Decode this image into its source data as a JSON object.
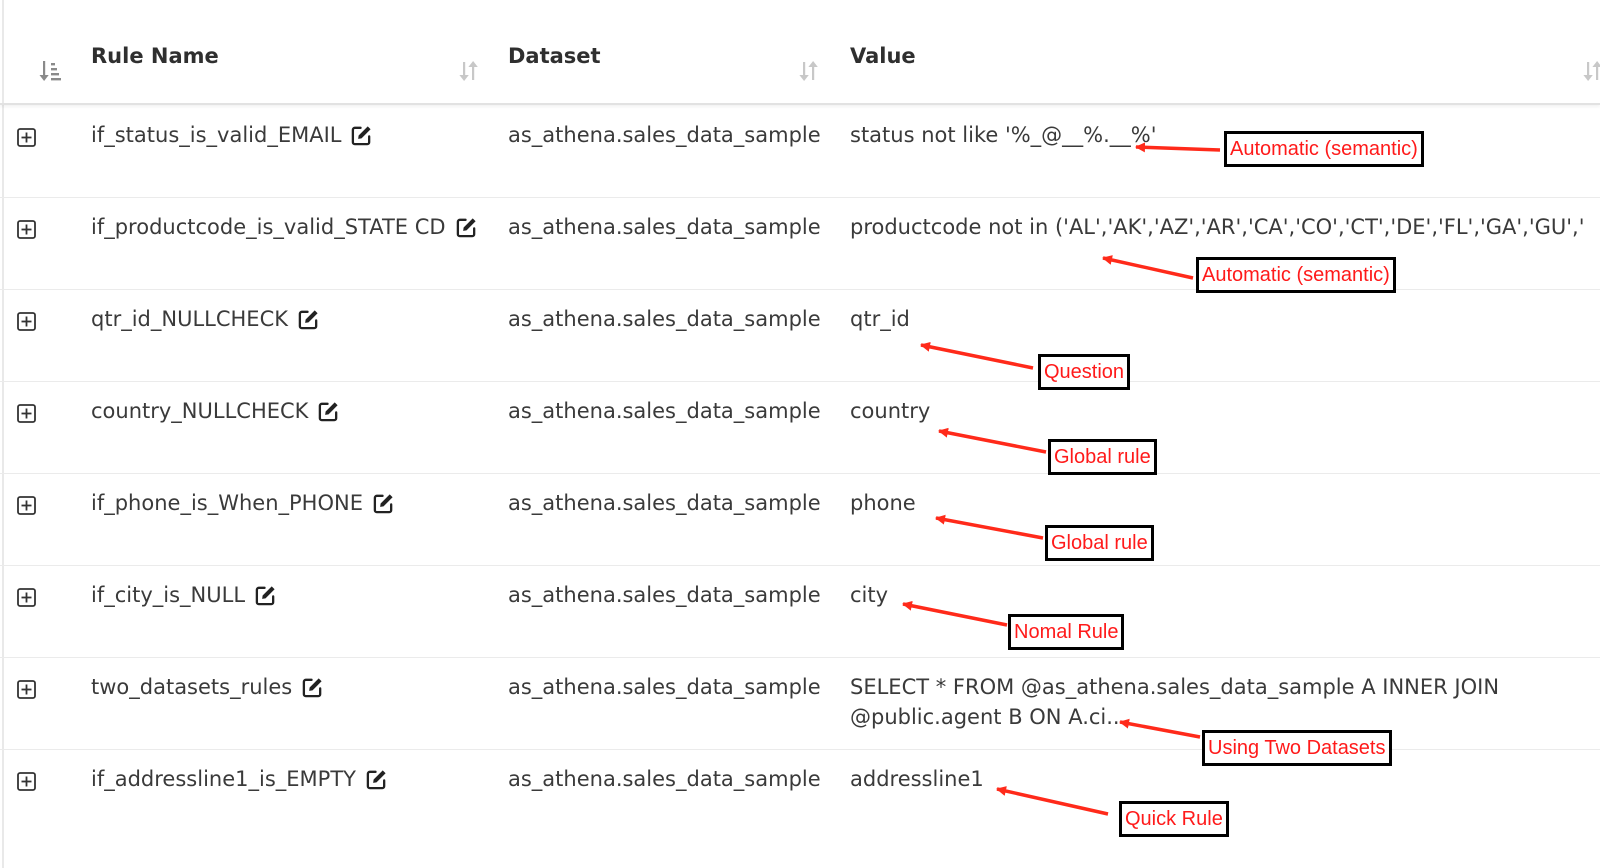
{
  "table": {
    "columns": [
      {
        "label": "Rule Name"
      },
      {
        "label": "Dataset"
      },
      {
        "label": "Value"
      }
    ],
    "rows": [
      {
        "rule_name": "if_status_is_valid_EMAIL",
        "dataset": "as_athena.sales_data_sample",
        "value": "status not like '%_@__%.__%'",
        "value2": ""
      },
      {
        "rule_name": "if_productcode_is_valid_STATE CD",
        "dataset": "as_athena.sales_data_sample",
        "value": "productcode not in ('AL','AK','AZ','AR','CA','CO','CT','DE','FL','GA','GU','HI',...",
        "value2": ""
      },
      {
        "rule_name": "qtr_id_NULLCHECK",
        "dataset": "as_athena.sales_data_sample",
        "value": "qtr_id",
        "value2": ""
      },
      {
        "rule_name": "country_NULLCHECK",
        "dataset": "as_athena.sales_data_sample",
        "value": "country",
        "value2": ""
      },
      {
        "rule_name": "if_phone_is_When_PHONE",
        "dataset": "as_athena.sales_data_sample",
        "value": "phone",
        "value2": ""
      },
      {
        "rule_name": "if_city_is_NULL",
        "dataset": "as_athena.sales_data_sample",
        "value": "city",
        "value2": ""
      },
      {
        "rule_name": "two_datasets_rules",
        "dataset": "as_athena.sales_data_sample",
        "value": "SELECT * FROM @as_athena.sales_data_sample A INNER JOIN",
        "value2": "@public.agent B ON A.ci..."
      },
      {
        "rule_name": "if_addressline1_is_EMPTY",
        "dataset": "as_athena.sales_data_sample",
        "value": "addressline1",
        "value2": ""
      }
    ]
  },
  "annotations": [
    "Automatic (semantic)",
    "Automatic (semantic)",
    "Question",
    "Global rule",
    "Global rule",
    "Nomal Rule",
    "Using Two Datasets",
    "Quick Rule"
  ],
  "colors": {
    "annotation_text": "#ff1a1a",
    "annotation_border": "#000000",
    "arrow": "#ff2a1a"
  }
}
